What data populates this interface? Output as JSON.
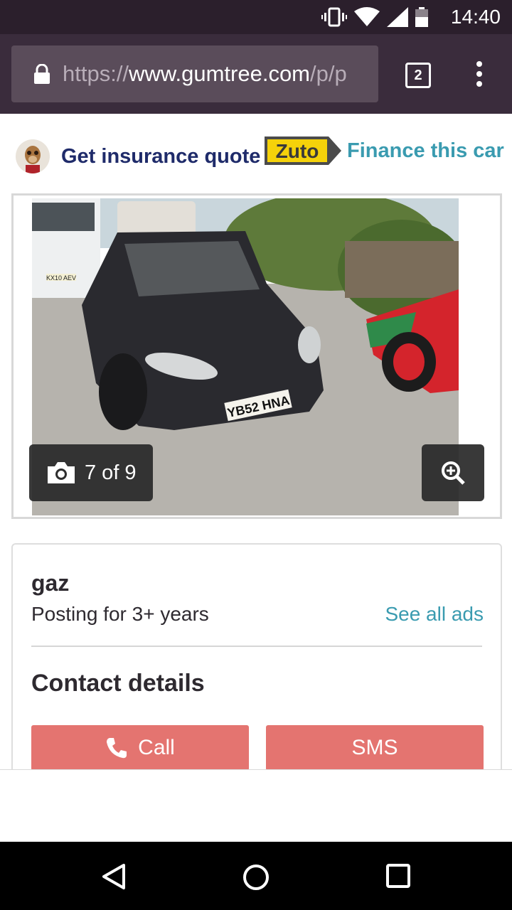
{
  "status_bar": {
    "time": "14:40"
  },
  "browser": {
    "url_prefix": "https://",
    "url_host": "www.gumtree.com",
    "url_path": "/p/p",
    "tab_count": "2"
  },
  "promo": {
    "insurance_label": "Get insurance quote",
    "zuto_logo_text": "Zuto",
    "finance_label": "Finance this car"
  },
  "gallery": {
    "counter": "7 of 9",
    "plate_text": "YB52 HNA",
    "van_plate_text": "KX10 AEV"
  },
  "seller": {
    "name": "gaz",
    "posting_for": "Posting for 3+ years",
    "see_all_ads": "See all ads"
  },
  "contact": {
    "heading": "Contact details",
    "call_label": "Call",
    "sms_label": "SMS"
  },
  "colors": {
    "status_bar": "#2b1f2c",
    "browser_bar": "#3a2c3c",
    "brand_blue": "#1f2b6a",
    "link_teal": "#3a9bb0",
    "button_red": "#e47470",
    "zuto_yellow": "#f5d20a"
  }
}
